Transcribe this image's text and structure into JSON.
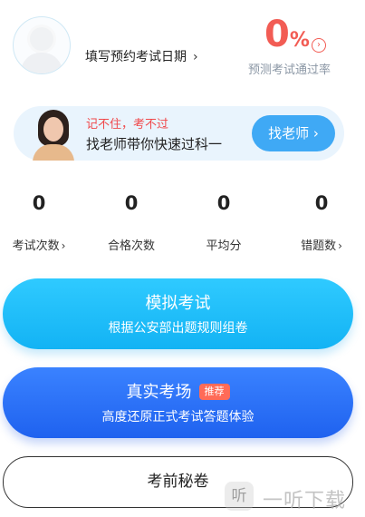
{
  "profile": {
    "date_link_label": "填写预约考试日期",
    "date_link_chevron": "›"
  },
  "pass_rate": {
    "value": "0",
    "unit": "%",
    "circle_chevron": "›",
    "label": "预测考试通过率",
    "accent_color": "#f25c54"
  },
  "banner": {
    "slogan": "记不住，考不过",
    "tagline": "找老师带你快速过科一",
    "button_label": "找老师",
    "button_chevron": "›"
  },
  "stats": [
    {
      "value": "0",
      "label": "考试次数",
      "chevron": "›"
    },
    {
      "value": "0",
      "label": "合格次数",
      "chevron": ""
    },
    {
      "value": "0",
      "label": "平均分",
      "chevron": ""
    },
    {
      "value": "0",
      "label": "错题数",
      "chevron": "›"
    }
  ],
  "mock_exam": {
    "title": "模拟考试",
    "subtitle": "根据公安部出题规则组卷",
    "color": "#13b3f4"
  },
  "real_exam": {
    "title": "真实考场",
    "badge": "推荐",
    "subtitle": "高度还原正式考试答题体验",
    "color": "#1f62ef"
  },
  "secret_paper": {
    "label": "考前秘卷"
  },
  "watermark": {
    "logo_glyph": "听",
    "text": "一听下载"
  }
}
